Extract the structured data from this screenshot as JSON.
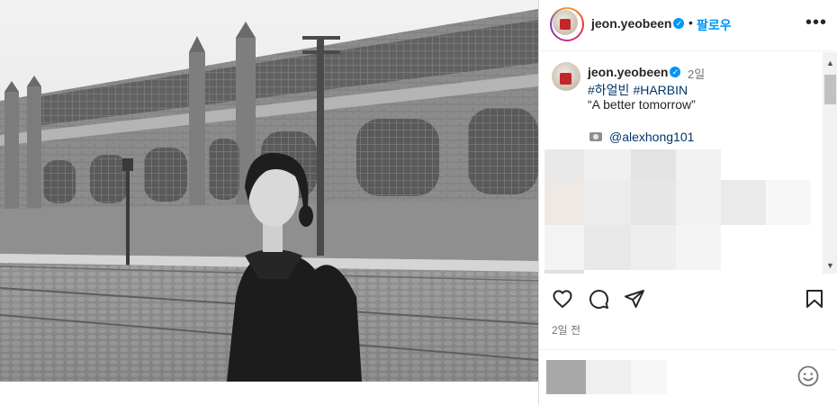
{
  "header": {
    "username": "jeon.yeobeen",
    "separator": "•",
    "follow_label": "팔로우",
    "more_icon": "more-options-icon"
  },
  "caption": {
    "username": "jeon.yeobeen",
    "time_ago": "2일",
    "hashtags": [
      "#하얼빈",
      "#HARBIN"
    ],
    "text": "“A better tomorrow”",
    "credit_handle": "@alexhong101",
    "credit_icon": "camera-icon"
  },
  "actions": {
    "like_icon": "heart-icon",
    "comment_icon": "comment-icon",
    "share_icon": "send-icon",
    "save_icon": "bookmark-icon"
  },
  "post_time": "2일 전",
  "composer": {
    "emoji_icon": "emoji-icon"
  },
  "colors": {
    "link": "#00376b",
    "follow": "#0095f6",
    "verified": "#0095f6",
    "meta": "#737373"
  }
}
